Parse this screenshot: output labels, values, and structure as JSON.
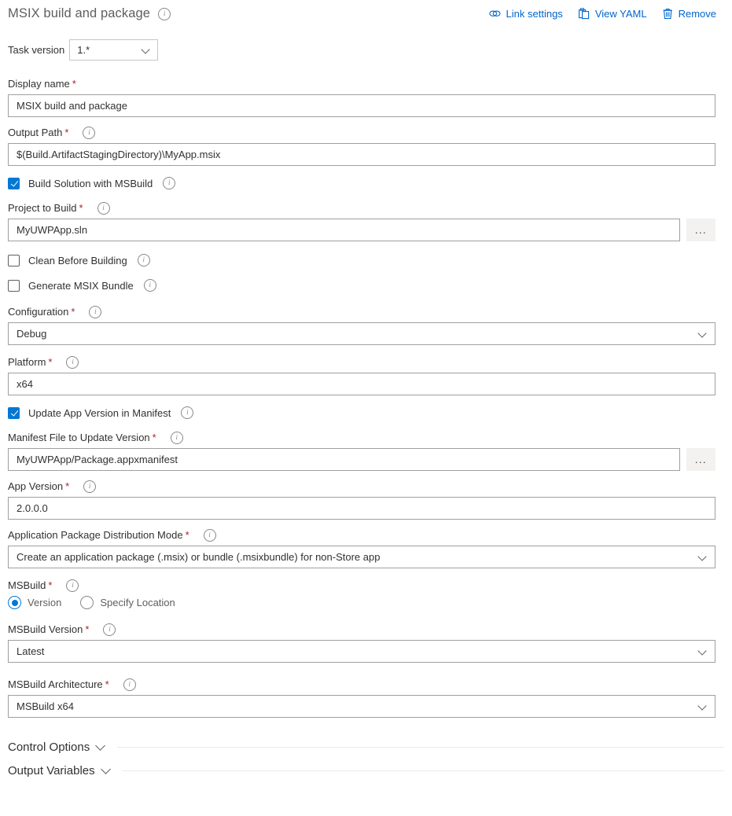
{
  "header": {
    "title": "MSIX build and package",
    "info_icon": "info-icon",
    "actions": [
      {
        "label": "Link settings",
        "icon": "link-icon"
      },
      {
        "label": "View YAML",
        "icon": "clipboard-icon"
      },
      {
        "label": "Remove",
        "icon": "trash-icon"
      }
    ],
    "link_color": "#0066cc"
  },
  "task_version": {
    "label": "Task version",
    "value": "1.*",
    "chevron_icon": "chevron-down-icon"
  },
  "fields": {
    "display_name": {
      "label": "Display name",
      "required": "*",
      "value": "MSIX build and package"
    },
    "output_path": {
      "label": "Output Path",
      "required": "*",
      "value": "$(Build.ArtifactStagingDirectory)\\MyApp.msix"
    },
    "build_solution": {
      "label": "Build Solution with MSBuild",
      "checked": true
    },
    "project_to_build": {
      "label": "Project to Build",
      "required": "*",
      "value": "MyUWPApp.sln",
      "browse_label": "..."
    },
    "clean_before_building": {
      "label": "Clean Before Building",
      "checked": false
    },
    "generate_msix_bundle": {
      "label": "Generate MSIX Bundle",
      "checked": false
    },
    "configuration": {
      "label": "Configuration",
      "required": "*",
      "value": "Debug"
    },
    "platform": {
      "label": "Platform",
      "required": "*",
      "value": "x64"
    },
    "update_app_version": {
      "label": "Update App Version in Manifest",
      "checked": true
    },
    "manifest_file": {
      "label": "Manifest File to Update Version",
      "required": "*",
      "value": "MyUWPApp/Package.appxmanifest",
      "browse_label": "..."
    },
    "app_version": {
      "label": "App Version",
      "required": "*",
      "value": "2.0.0.0"
    },
    "distribution_mode": {
      "label": "Application Package Distribution Mode",
      "required": "*",
      "value": "Create an application package (.msix) or bundle (.msixbundle) for non-Store app"
    },
    "msbuild": {
      "label": "MSBuild",
      "required": "*",
      "options": [
        {
          "label": "Version",
          "selected": true
        },
        {
          "label": "Specify Location",
          "selected": false
        }
      ]
    },
    "msbuild_version": {
      "label": "MSBuild Version",
      "required": "*",
      "value": "Latest"
    },
    "msbuild_architecture": {
      "label": "MSBuild Architecture",
      "required": "*",
      "value": "MSBuild x64"
    }
  },
  "sections": [
    {
      "title": "Control Options",
      "chevron_icon": "chevron-down-icon"
    },
    {
      "title": "Output Variables",
      "chevron_icon": "chevron-down-icon"
    }
  ],
  "colors": {
    "accent": "#0078d4",
    "link": "#0066cc",
    "required_asterisk": "#a4262c",
    "border": "#a19f9d"
  }
}
